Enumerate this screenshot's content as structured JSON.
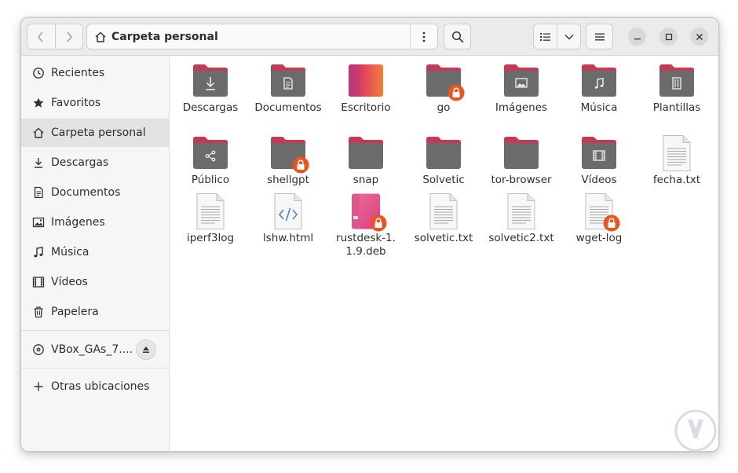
{
  "header": {
    "path_label": "Carpeta personal"
  },
  "sidebar": {
    "items": [
      {
        "label": "Recientes",
        "icon": "clock-icon"
      },
      {
        "label": "Favoritos",
        "icon": "star-icon"
      },
      {
        "label": "Carpeta personal",
        "icon": "home-icon"
      },
      {
        "label": "Descargas",
        "icon": "download-icon"
      },
      {
        "label": "Documentos",
        "icon": "document-icon"
      },
      {
        "label": "Imágenes",
        "icon": "image-icon"
      },
      {
        "label": "Música",
        "icon": "music-icon"
      },
      {
        "label": "Vídeos",
        "icon": "film-icon"
      },
      {
        "label": "Papelera",
        "icon": "trash-icon"
      }
    ],
    "device": {
      "label": "VBox_GAs_7....",
      "icon": "disc-icon"
    },
    "other": {
      "label": "Otras ubicaciones",
      "icon": "plus-icon"
    }
  },
  "files": [
    {
      "name": "Descargas",
      "type": "folder",
      "emblem": "download"
    },
    {
      "name": "Documentos",
      "type": "folder",
      "emblem": "document"
    },
    {
      "name": "Escritorio",
      "type": "desktop-folder",
      "emblem": "none"
    },
    {
      "name": "go",
      "type": "folder",
      "emblem": "none",
      "locked": true
    },
    {
      "name": "Imágenes",
      "type": "folder",
      "emblem": "image"
    },
    {
      "name": "Música",
      "type": "folder",
      "emblem": "music"
    },
    {
      "name": "Plantillas",
      "type": "folder",
      "emblem": "template"
    },
    {
      "name": "Público",
      "type": "folder",
      "emblem": "share"
    },
    {
      "name": "shellgpt",
      "type": "folder",
      "emblem": "none",
      "locked": true
    },
    {
      "name": "snap",
      "type": "folder",
      "emblem": "none"
    },
    {
      "name": "Solvetic",
      "type": "folder",
      "emblem": "none"
    },
    {
      "name": "tor-browser",
      "type": "folder",
      "emblem": "none"
    },
    {
      "name": "Vídeos",
      "type": "folder",
      "emblem": "film"
    },
    {
      "name": "fecha.txt",
      "type": "text"
    },
    {
      "name": "iperf3log",
      "type": "text"
    },
    {
      "name": "lshw.html",
      "type": "html"
    },
    {
      "name": "rustdesk-1.1.9.deb",
      "type": "package",
      "locked": true
    },
    {
      "name": "solvetic.txt",
      "type": "text"
    },
    {
      "name": "solvetic2.txt",
      "type": "text"
    },
    {
      "name": "wget-log",
      "type": "text",
      "locked": true
    }
  ],
  "colors": {
    "folder_body": "#6b6b6b",
    "folder_tab": "#c23a55",
    "lock_badge": "#e95420",
    "accent": "#e95420"
  }
}
